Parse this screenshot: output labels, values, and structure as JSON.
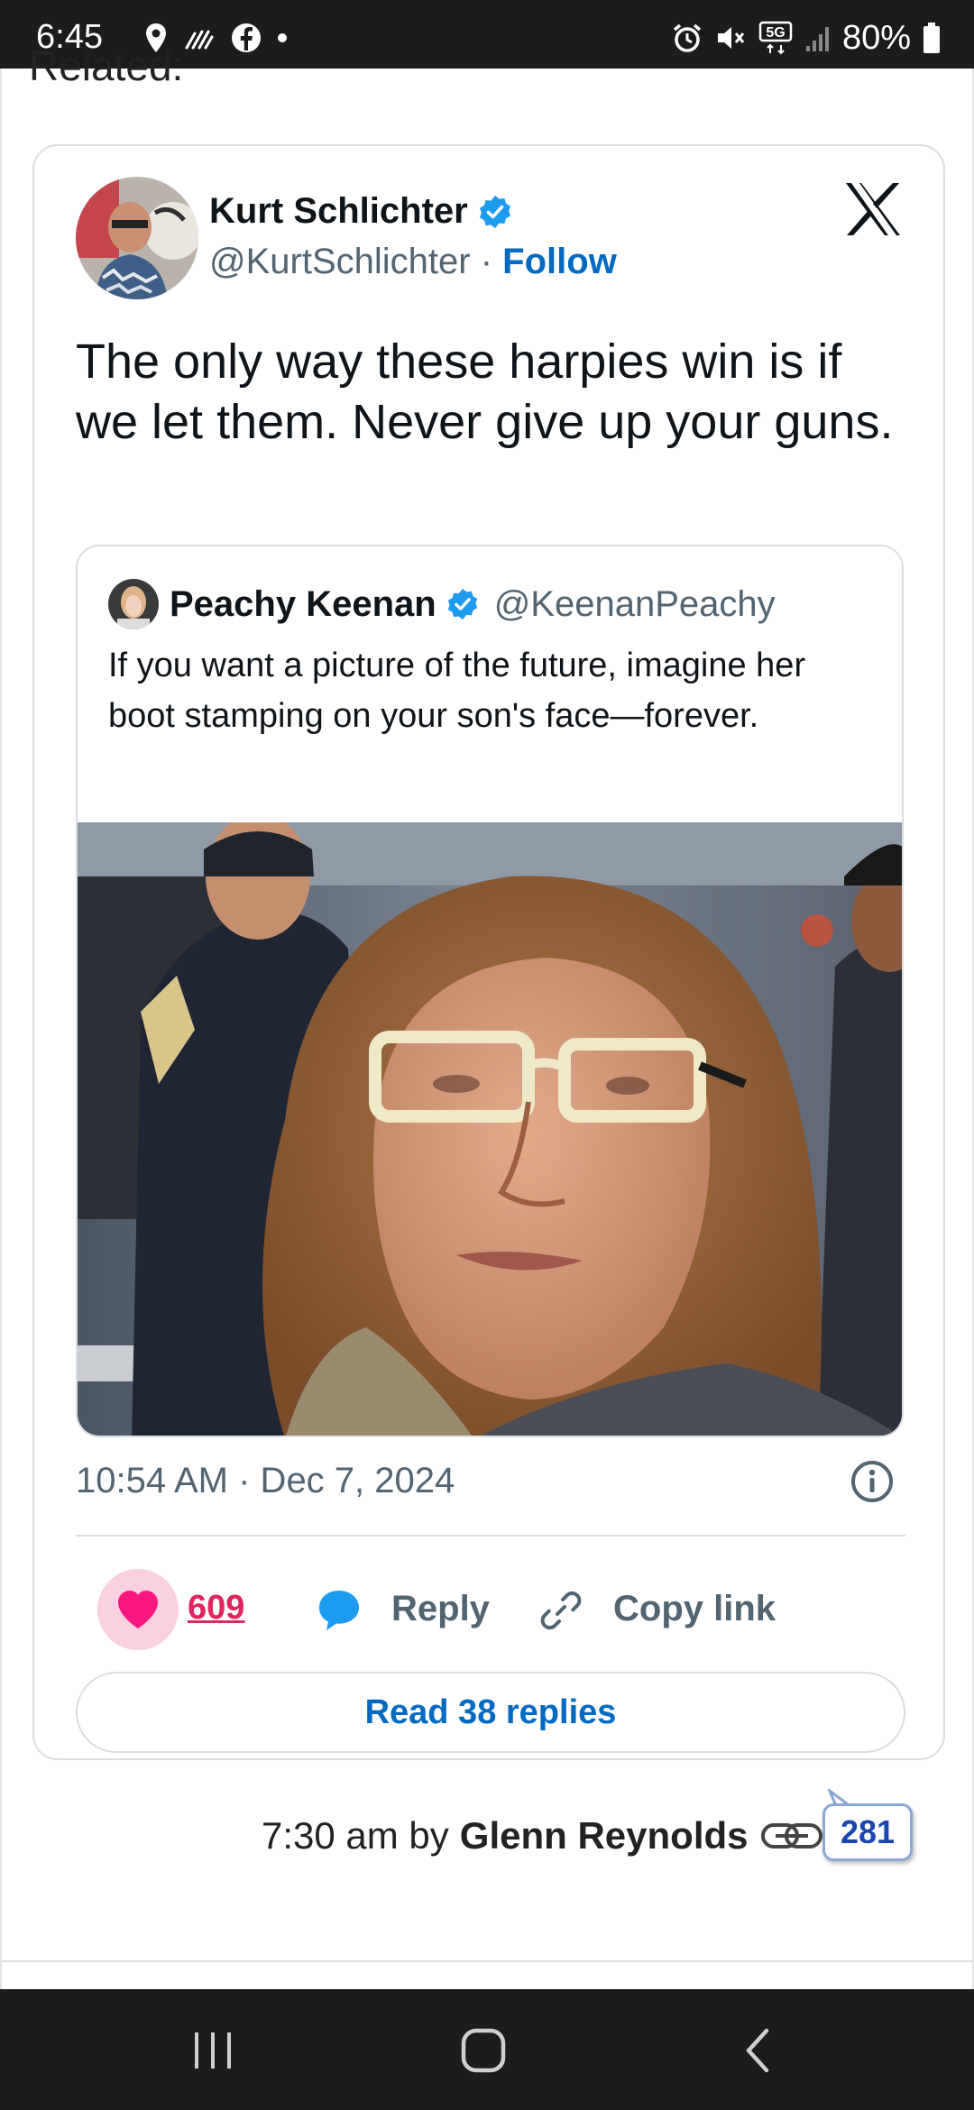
{
  "status_bar": {
    "time": "6:45",
    "battery": "80%",
    "network": "5G"
  },
  "page": {
    "related_heading": "Related:"
  },
  "tweet": {
    "author_name": "Kurt Schlichter",
    "author_handle": "@KurtSchlichter",
    "separator": "·",
    "follow_label": "Follow",
    "text": "The only way these harpies win is if we let them. Never give up your guns.",
    "quoted": {
      "author_name": "Peachy Keenan",
      "author_handle": "@KeenanPeachy",
      "text": "If you want a picture of the future, imagine her boot stamping on your son's face—forever."
    },
    "timestamp": "10:54 AM · Dec 7, 2024",
    "like_count": "609",
    "reply_label": "Reply",
    "copy_link_label": "Copy link",
    "read_replies_label": "Read 38 replies"
  },
  "byline": {
    "time": "7:30 am by",
    "author": "Glenn Reynolds",
    "comment_count": "281"
  },
  "colors": {
    "link_blue": "#0069c2",
    "like_pink": "#f91880",
    "verified_blue": "#1d9bf0",
    "bar_dark": "#1c1c1c"
  },
  "icons": [
    "location-icon",
    "signal-scribble-icon",
    "facebook-icon",
    "alarm-icon",
    "mute-icon",
    "signal-bars-icon",
    "battery-icon",
    "verified-badge-icon",
    "x-logo-icon",
    "info-icon",
    "heart-icon",
    "reply-bubble-icon",
    "link-icon",
    "chain-link-icon",
    "recents-icon",
    "home-icon",
    "back-icon"
  ]
}
